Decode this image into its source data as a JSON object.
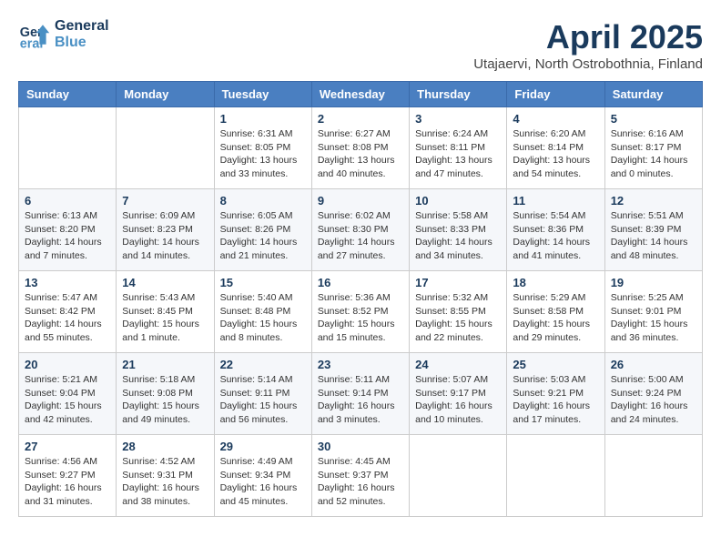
{
  "header": {
    "logo_line1": "General",
    "logo_line2": "Blue",
    "month": "April 2025",
    "location": "Utajaervi, North Ostrobothnia, Finland"
  },
  "weekdays": [
    "Sunday",
    "Monday",
    "Tuesday",
    "Wednesday",
    "Thursday",
    "Friday",
    "Saturday"
  ],
  "weeks": [
    [
      {
        "day": "",
        "sunrise": "",
        "sunset": "",
        "daylight": ""
      },
      {
        "day": "",
        "sunrise": "",
        "sunset": "",
        "daylight": ""
      },
      {
        "day": "1",
        "sunrise": "Sunrise: 6:31 AM",
        "sunset": "Sunset: 8:05 PM",
        "daylight": "Daylight: 13 hours and 33 minutes."
      },
      {
        "day": "2",
        "sunrise": "Sunrise: 6:27 AM",
        "sunset": "Sunset: 8:08 PM",
        "daylight": "Daylight: 13 hours and 40 minutes."
      },
      {
        "day": "3",
        "sunrise": "Sunrise: 6:24 AM",
        "sunset": "Sunset: 8:11 PM",
        "daylight": "Daylight: 13 hours and 47 minutes."
      },
      {
        "day": "4",
        "sunrise": "Sunrise: 6:20 AM",
        "sunset": "Sunset: 8:14 PM",
        "daylight": "Daylight: 13 hours and 54 minutes."
      },
      {
        "day": "5",
        "sunrise": "Sunrise: 6:16 AM",
        "sunset": "Sunset: 8:17 PM",
        "daylight": "Daylight: 14 hours and 0 minutes."
      }
    ],
    [
      {
        "day": "6",
        "sunrise": "Sunrise: 6:13 AM",
        "sunset": "Sunset: 8:20 PM",
        "daylight": "Daylight: 14 hours and 7 minutes."
      },
      {
        "day": "7",
        "sunrise": "Sunrise: 6:09 AM",
        "sunset": "Sunset: 8:23 PM",
        "daylight": "Daylight: 14 hours and 14 minutes."
      },
      {
        "day": "8",
        "sunrise": "Sunrise: 6:05 AM",
        "sunset": "Sunset: 8:26 PM",
        "daylight": "Daylight: 14 hours and 21 minutes."
      },
      {
        "day": "9",
        "sunrise": "Sunrise: 6:02 AM",
        "sunset": "Sunset: 8:30 PM",
        "daylight": "Daylight: 14 hours and 27 minutes."
      },
      {
        "day": "10",
        "sunrise": "Sunrise: 5:58 AM",
        "sunset": "Sunset: 8:33 PM",
        "daylight": "Daylight: 14 hours and 34 minutes."
      },
      {
        "day": "11",
        "sunrise": "Sunrise: 5:54 AM",
        "sunset": "Sunset: 8:36 PM",
        "daylight": "Daylight: 14 hours and 41 minutes."
      },
      {
        "day": "12",
        "sunrise": "Sunrise: 5:51 AM",
        "sunset": "Sunset: 8:39 PM",
        "daylight": "Daylight: 14 hours and 48 minutes."
      }
    ],
    [
      {
        "day": "13",
        "sunrise": "Sunrise: 5:47 AM",
        "sunset": "Sunset: 8:42 PM",
        "daylight": "Daylight: 14 hours and 55 minutes."
      },
      {
        "day": "14",
        "sunrise": "Sunrise: 5:43 AM",
        "sunset": "Sunset: 8:45 PM",
        "daylight": "Daylight: 15 hours and 1 minute."
      },
      {
        "day": "15",
        "sunrise": "Sunrise: 5:40 AM",
        "sunset": "Sunset: 8:48 PM",
        "daylight": "Daylight: 15 hours and 8 minutes."
      },
      {
        "day": "16",
        "sunrise": "Sunrise: 5:36 AM",
        "sunset": "Sunset: 8:52 PM",
        "daylight": "Daylight: 15 hours and 15 minutes."
      },
      {
        "day": "17",
        "sunrise": "Sunrise: 5:32 AM",
        "sunset": "Sunset: 8:55 PM",
        "daylight": "Daylight: 15 hours and 22 minutes."
      },
      {
        "day": "18",
        "sunrise": "Sunrise: 5:29 AM",
        "sunset": "Sunset: 8:58 PM",
        "daylight": "Daylight: 15 hours and 29 minutes."
      },
      {
        "day": "19",
        "sunrise": "Sunrise: 5:25 AM",
        "sunset": "Sunset: 9:01 PM",
        "daylight": "Daylight: 15 hours and 36 minutes."
      }
    ],
    [
      {
        "day": "20",
        "sunrise": "Sunrise: 5:21 AM",
        "sunset": "Sunset: 9:04 PM",
        "daylight": "Daylight: 15 hours and 42 minutes."
      },
      {
        "day": "21",
        "sunrise": "Sunrise: 5:18 AM",
        "sunset": "Sunset: 9:08 PM",
        "daylight": "Daylight: 15 hours and 49 minutes."
      },
      {
        "day": "22",
        "sunrise": "Sunrise: 5:14 AM",
        "sunset": "Sunset: 9:11 PM",
        "daylight": "Daylight: 15 hours and 56 minutes."
      },
      {
        "day": "23",
        "sunrise": "Sunrise: 5:11 AM",
        "sunset": "Sunset: 9:14 PM",
        "daylight": "Daylight: 16 hours and 3 minutes."
      },
      {
        "day": "24",
        "sunrise": "Sunrise: 5:07 AM",
        "sunset": "Sunset: 9:17 PM",
        "daylight": "Daylight: 16 hours and 10 minutes."
      },
      {
        "day": "25",
        "sunrise": "Sunrise: 5:03 AM",
        "sunset": "Sunset: 9:21 PM",
        "daylight": "Daylight: 16 hours and 17 minutes."
      },
      {
        "day": "26",
        "sunrise": "Sunrise: 5:00 AM",
        "sunset": "Sunset: 9:24 PM",
        "daylight": "Daylight: 16 hours and 24 minutes."
      }
    ],
    [
      {
        "day": "27",
        "sunrise": "Sunrise: 4:56 AM",
        "sunset": "Sunset: 9:27 PM",
        "daylight": "Daylight: 16 hours and 31 minutes."
      },
      {
        "day": "28",
        "sunrise": "Sunrise: 4:52 AM",
        "sunset": "Sunset: 9:31 PM",
        "daylight": "Daylight: 16 hours and 38 minutes."
      },
      {
        "day": "29",
        "sunrise": "Sunrise: 4:49 AM",
        "sunset": "Sunset: 9:34 PM",
        "daylight": "Daylight: 16 hours and 45 minutes."
      },
      {
        "day": "30",
        "sunrise": "Sunrise: 4:45 AM",
        "sunset": "Sunset: 9:37 PM",
        "daylight": "Daylight: 16 hours and 52 minutes."
      },
      {
        "day": "",
        "sunrise": "",
        "sunset": "",
        "daylight": ""
      },
      {
        "day": "",
        "sunrise": "",
        "sunset": "",
        "daylight": ""
      },
      {
        "day": "",
        "sunrise": "",
        "sunset": "",
        "daylight": ""
      }
    ]
  ]
}
